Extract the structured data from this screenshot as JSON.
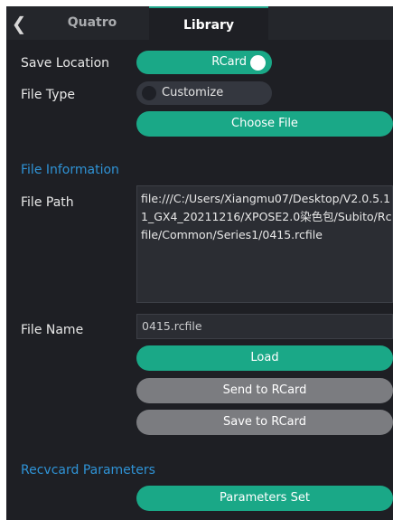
{
  "tabs": {
    "quatro": "Quatro",
    "library": "Library"
  },
  "icons": {
    "back": "chevron-left-icon"
  },
  "save_location": {
    "label": "Save Location",
    "value": "RCard",
    "on": true
  },
  "file_type": {
    "label": "File Type",
    "value": "Customize",
    "on": false
  },
  "choose_file": "Choose File",
  "file_info": {
    "heading": "File Information",
    "path_label": "File Path",
    "path_value": "file:///C:/Users/Xiangmu07/Desktop/V2.0.5.11_GX4_20211216/XPOSE2.0染色包/Subito/Rcfile/Common/Series1/0415.rcfile",
    "name_label": "File Name",
    "name_value": "0415.rcfile"
  },
  "actions": {
    "load": "Load",
    "send": "Send to RCard",
    "save": "Save to RCard"
  },
  "recv": {
    "heading": "Recvcard Parameters",
    "button": "Parameters Set"
  },
  "colors": {
    "accent": "#1aa887",
    "section": "#2f93d6",
    "disabled": "#7b7c80",
    "background": "#1e1f24"
  }
}
